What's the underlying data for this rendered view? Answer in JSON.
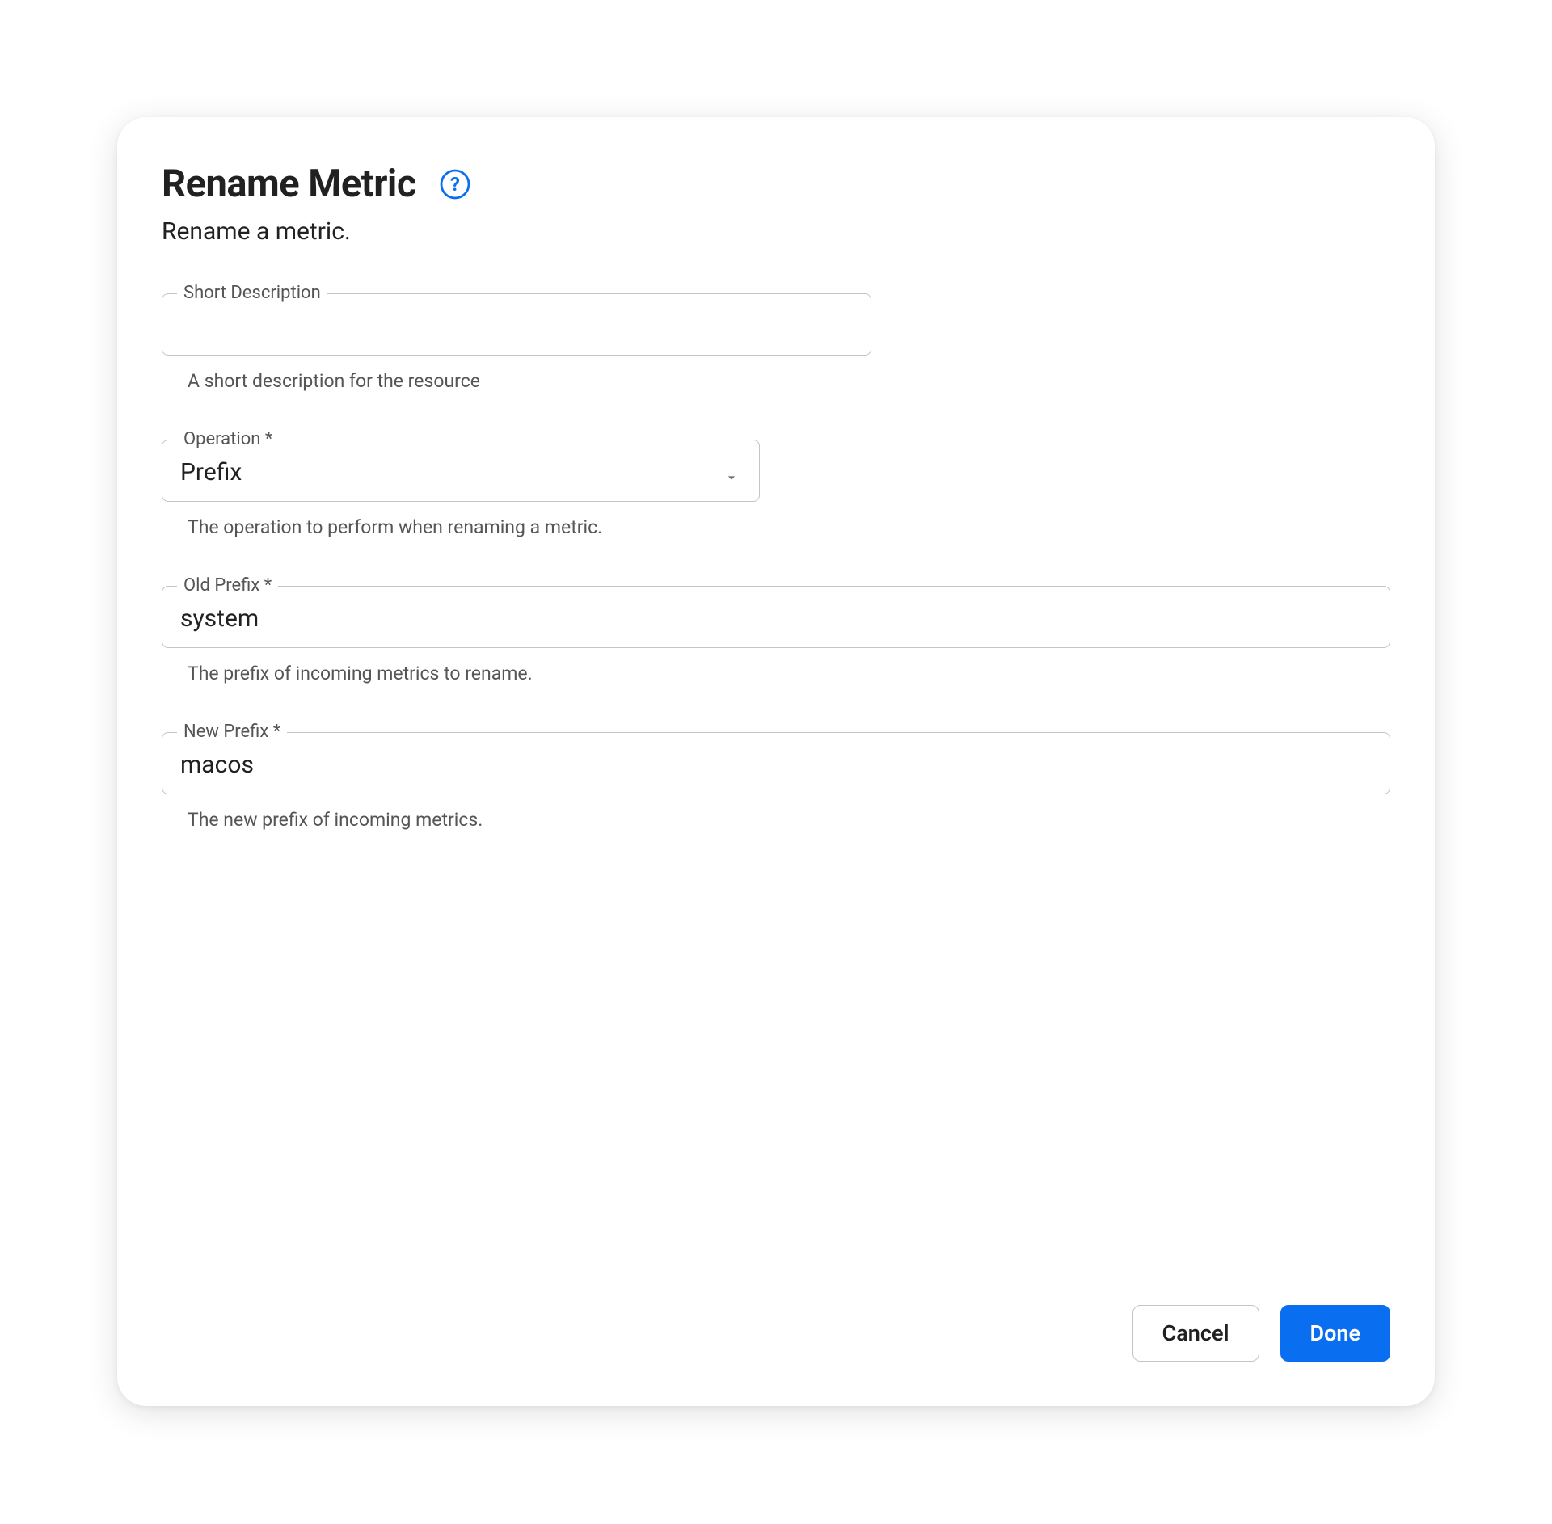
{
  "header": {
    "title": "Rename Metric",
    "subtitle": "Rename a metric."
  },
  "fields": {
    "shortDescription": {
      "label": "Short Description",
      "value": "",
      "helper": "A short description for the resource"
    },
    "operation": {
      "label": "Operation *",
      "selected": "Prefix",
      "helper": "The operation to perform when renaming a metric."
    },
    "oldPrefix": {
      "label": "Old Prefix *",
      "value": "system",
      "helper": "The prefix of incoming metrics to rename."
    },
    "newPrefix": {
      "label": "New Prefix *",
      "value": "macos",
      "helper": "The new prefix of incoming metrics."
    }
  },
  "buttons": {
    "cancel": "Cancel",
    "done": "Done"
  }
}
